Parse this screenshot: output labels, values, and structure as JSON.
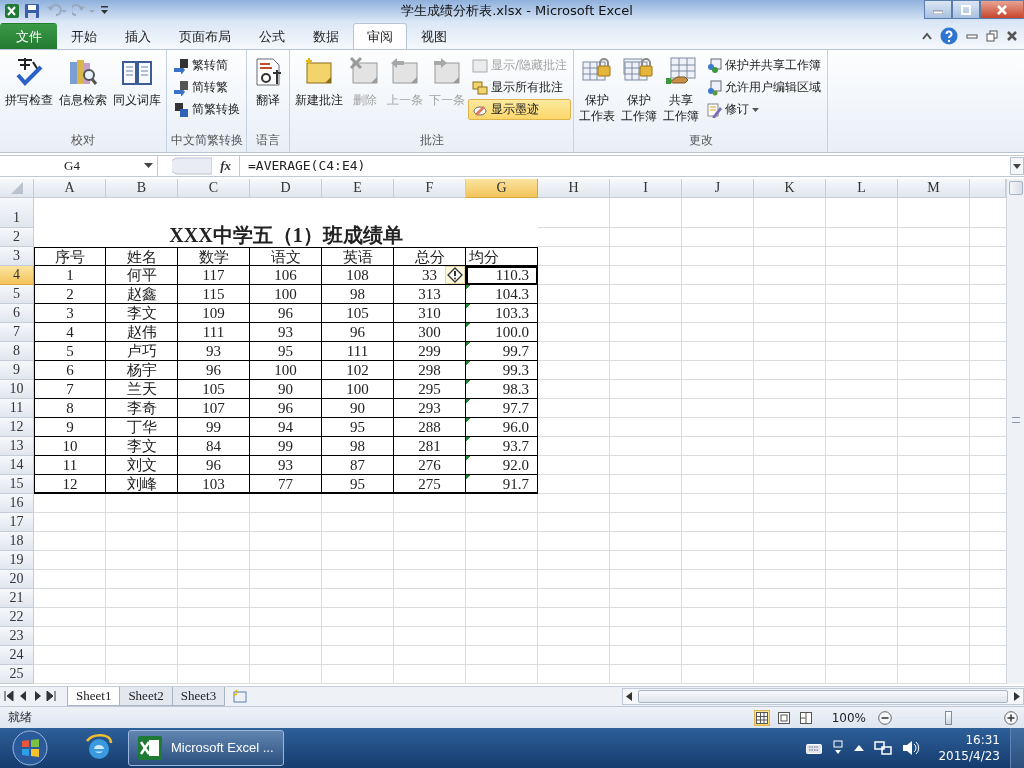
{
  "window": {
    "title": "学生成绩分析表.xlsx - Microsoft Excel"
  },
  "ribbon_tabs": [
    {
      "label": "文件",
      "kind": "file",
      "selected": false
    },
    {
      "label": "开始",
      "kind": "tab",
      "selected": false
    },
    {
      "label": "插入",
      "kind": "tab",
      "selected": false
    },
    {
      "label": "页面布局",
      "kind": "tab",
      "selected": false
    },
    {
      "label": "公式",
      "kind": "tab",
      "selected": false
    },
    {
      "label": "数据",
      "kind": "tab",
      "selected": false
    },
    {
      "label": "审阅",
      "kind": "tab",
      "selected": true
    },
    {
      "label": "视图",
      "kind": "tab",
      "selected": false
    }
  ],
  "ribbon_groups": [
    {
      "label": "校对",
      "buttons": [
        {
          "label": "拼写检查",
          "kind": "large",
          "disabled": false,
          "selected": false
        },
        {
          "label": "信息检索",
          "kind": "large",
          "disabled": false,
          "selected": false
        },
        {
          "label": "同义词库",
          "kind": "large",
          "disabled": false,
          "selected": false
        }
      ]
    },
    {
      "label": "中文简繁转换",
      "buttons": [
        {
          "label": "繁转简",
          "kind": "small",
          "disabled": false,
          "selected": false
        },
        {
          "label": "简转繁",
          "kind": "small",
          "disabled": false,
          "selected": false
        },
        {
          "label": "简繁转换",
          "kind": "small",
          "disabled": false,
          "selected": false
        }
      ]
    },
    {
      "label": "语言",
      "buttons": [
        {
          "label": "翻译",
          "kind": "large",
          "disabled": false,
          "selected": false
        }
      ]
    },
    {
      "label": "批注",
      "buttons": [
        {
          "label": "新建批注",
          "kind": "large",
          "disabled": false,
          "selected": false
        },
        {
          "label": "删除",
          "kind": "large",
          "disabled": true,
          "selected": false
        },
        {
          "label": "上一条",
          "kind": "large",
          "disabled": true,
          "selected": false
        },
        {
          "label": "下一条",
          "kind": "large",
          "disabled": true,
          "selected": false
        },
        {
          "label": "显示/隐藏批注",
          "kind": "small",
          "disabled": true,
          "selected": false
        },
        {
          "label": "显示所有批注",
          "kind": "small",
          "disabled": false,
          "selected": false
        },
        {
          "label": "显示墨迹",
          "kind": "small",
          "disabled": false,
          "selected": true
        }
      ]
    },
    {
      "label": "更改",
      "buttons": [
        {
          "label_lines": [
            "保护",
            "工作表"
          ],
          "kind": "large",
          "disabled": false,
          "selected": false
        },
        {
          "label_lines": [
            "保护",
            "工作簿"
          ],
          "kind": "large",
          "disabled": false,
          "selected": false
        },
        {
          "label_lines": [
            "共享",
            "工作簿"
          ],
          "kind": "large",
          "disabled": false,
          "selected": false
        },
        {
          "label": "保护并共享工作簿",
          "kind": "small",
          "disabled": false,
          "selected": false
        },
        {
          "label": "允许用户编辑区域",
          "kind": "small",
          "disabled": false,
          "selected": false
        },
        {
          "label": "修订",
          "kind": "dropdown",
          "disabled": false,
          "selected": false
        }
      ]
    }
  ],
  "formula_bar": {
    "name_box": "G4",
    "insert_function": "fx",
    "formula": "=AVERAGE(C4:E4)"
  },
  "sheet": {
    "columns": [
      {
        "label": "A",
        "selected": false
      },
      {
        "label": "B",
        "selected": false
      },
      {
        "label": "C",
        "selected": false
      },
      {
        "label": "D",
        "selected": false
      },
      {
        "label": "E",
        "selected": false
      },
      {
        "label": "F",
        "selected": false
      },
      {
        "label": "G",
        "selected": true
      },
      {
        "label": "H",
        "selected": false
      },
      {
        "label": "I",
        "selected": false
      },
      {
        "label": "J",
        "selected": false
      },
      {
        "label": "K",
        "selected": false
      },
      {
        "label": "L",
        "selected": false
      },
      {
        "label": "M",
        "selected": false
      }
    ],
    "row_numbers": [
      {
        "label": "1",
        "selected": false
      },
      {
        "label": "2",
        "selected": false
      },
      {
        "label": "3",
        "selected": false
      },
      {
        "label": "4",
        "selected": true
      },
      {
        "label": "5",
        "selected": false
      },
      {
        "label": "6",
        "selected": false
      },
      {
        "label": "7",
        "selected": false
      },
      {
        "label": "8",
        "selected": false
      },
      {
        "label": "9",
        "selected": false
      },
      {
        "label": "10",
        "selected": false
      },
      {
        "label": "11",
        "selected": false
      },
      {
        "label": "12",
        "selected": false
      },
      {
        "label": "13",
        "selected": false
      },
      {
        "label": "14",
        "selected": false
      },
      {
        "label": "15",
        "selected": false
      },
      {
        "label": "16",
        "selected": false
      },
      {
        "label": "17",
        "selected": false
      },
      {
        "label": "18",
        "selected": false
      },
      {
        "label": "19",
        "selected": false
      },
      {
        "label": "20",
        "selected": false
      },
      {
        "label": "21",
        "selected": false
      },
      {
        "label": "22",
        "selected": false
      },
      {
        "label": "23",
        "selected": false
      },
      {
        "label": "24",
        "selected": false
      },
      {
        "label": "25",
        "selected": false
      }
    ],
    "title": "XXX中学五（1）班成绩单",
    "header": [
      "序号",
      "姓名",
      "数学",
      "语文",
      "英语",
      "总分",
      "均分"
    ],
    "rows": [
      {
        "cells": [
          "1",
          "何平",
          "117",
          "106",
          "108",
          "33",
          "110.3"
        ],
        "flagged": true
      },
      {
        "cells": [
          "2",
          "赵鑫",
          "115",
          "100",
          "98",
          "313",
          "104.3"
        ],
        "flagged": true
      },
      {
        "cells": [
          "3",
          "李文",
          "109",
          "96",
          "105",
          "310",
          "103.3"
        ],
        "flagged": true
      },
      {
        "cells": [
          "4",
          "赵伟",
          "111",
          "93",
          "96",
          "300",
          "100.0"
        ],
        "flagged": true
      },
      {
        "cells": [
          "5",
          "卢巧",
          "93",
          "95",
          "111",
          "299",
          "99.7"
        ],
        "flagged": true
      },
      {
        "cells": [
          "6",
          "杨宇",
          "96",
          "100",
          "102",
          "298",
          "99.3"
        ],
        "flagged": true
      },
      {
        "cells": [
          "7",
          "兰天",
          "105",
          "90",
          "100",
          "295",
          "98.3"
        ],
        "flagged": true
      },
      {
        "cells": [
          "8",
          "李奇",
          "107",
          "96",
          "90",
          "293",
          "97.7"
        ],
        "flagged": true
      },
      {
        "cells": [
          "9",
          "丁华",
          "99",
          "94",
          "95",
          "288",
          "96.0"
        ],
        "flagged": true
      },
      {
        "cells": [
          "10",
          "李文",
          "84",
          "99",
          "98",
          "281",
          "93.7"
        ],
        "flagged": true
      },
      {
        "cells": [
          "11",
          "刘文",
          "96",
          "93",
          "87",
          "276",
          "92.0"
        ],
        "flagged": true
      },
      {
        "cells": [
          "12",
          "刘峰",
          "103",
          "77",
          "95",
          "275",
          "91.7"
        ],
        "flagged": true
      }
    ]
  },
  "sheet_tabs": [
    {
      "label": "Sheet1",
      "selected": true
    },
    {
      "label": "Sheet2",
      "selected": false
    },
    {
      "label": "Sheet3",
      "selected": false
    }
  ],
  "status_bar": {
    "status": "就绪",
    "views": [
      {
        "kind": "normal",
        "selected": true
      },
      {
        "kind": "layout",
        "selected": false
      },
      {
        "kind": "pagebreak",
        "selected": false
      }
    ],
    "zoom": "100%",
    "zoom_slider": {
      "level": 0.5
    }
  },
  "taskbar": {
    "tasks": [
      {
        "label": "Microsoft Excel ...",
        "selected": true
      }
    ],
    "time": "16:31",
    "date": "2015/4/23"
  }
}
